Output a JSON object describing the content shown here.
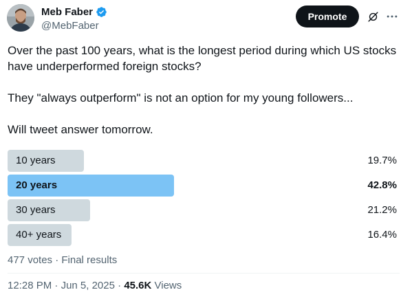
{
  "author": {
    "display_name": "Meb Faber",
    "handle": "@MebFaber",
    "verified_color": "#1d9bf0",
    "avatar_icon": "user-avatar-photo"
  },
  "actions": {
    "promote_label": "Promote",
    "grok_icon": "grok-icon",
    "more_icon": "more-dots-icon"
  },
  "tweet": {
    "lines": [
      "Over the past 100 years, what is the longest period during which US stocks have underperformed foreign stocks?",
      "They \"always outperform\" is not an option for my young followers...",
      "Will tweet answer tomorrow."
    ]
  },
  "poll": {
    "options": [
      {
        "label": "10 years",
        "percent": "19.7%",
        "value": 19.7,
        "winner": false
      },
      {
        "label": "20 years",
        "percent": "42.8%",
        "value": 42.8,
        "winner": true
      },
      {
        "label": "30 years",
        "percent": "21.2%",
        "value": 21.2,
        "winner": false
      },
      {
        "label": "40+ years",
        "percent": "16.4%",
        "value": 16.4,
        "winner": false
      }
    ],
    "meta": "477 votes · Final results",
    "bar_color": "#cfd9de",
    "winner_color": "#7cc3f5"
  },
  "footer": {
    "time": "12:28 PM",
    "separator": " · ",
    "date": "Jun 5, 2025",
    "views_count": "45.6K",
    "views_label": " Views"
  }
}
